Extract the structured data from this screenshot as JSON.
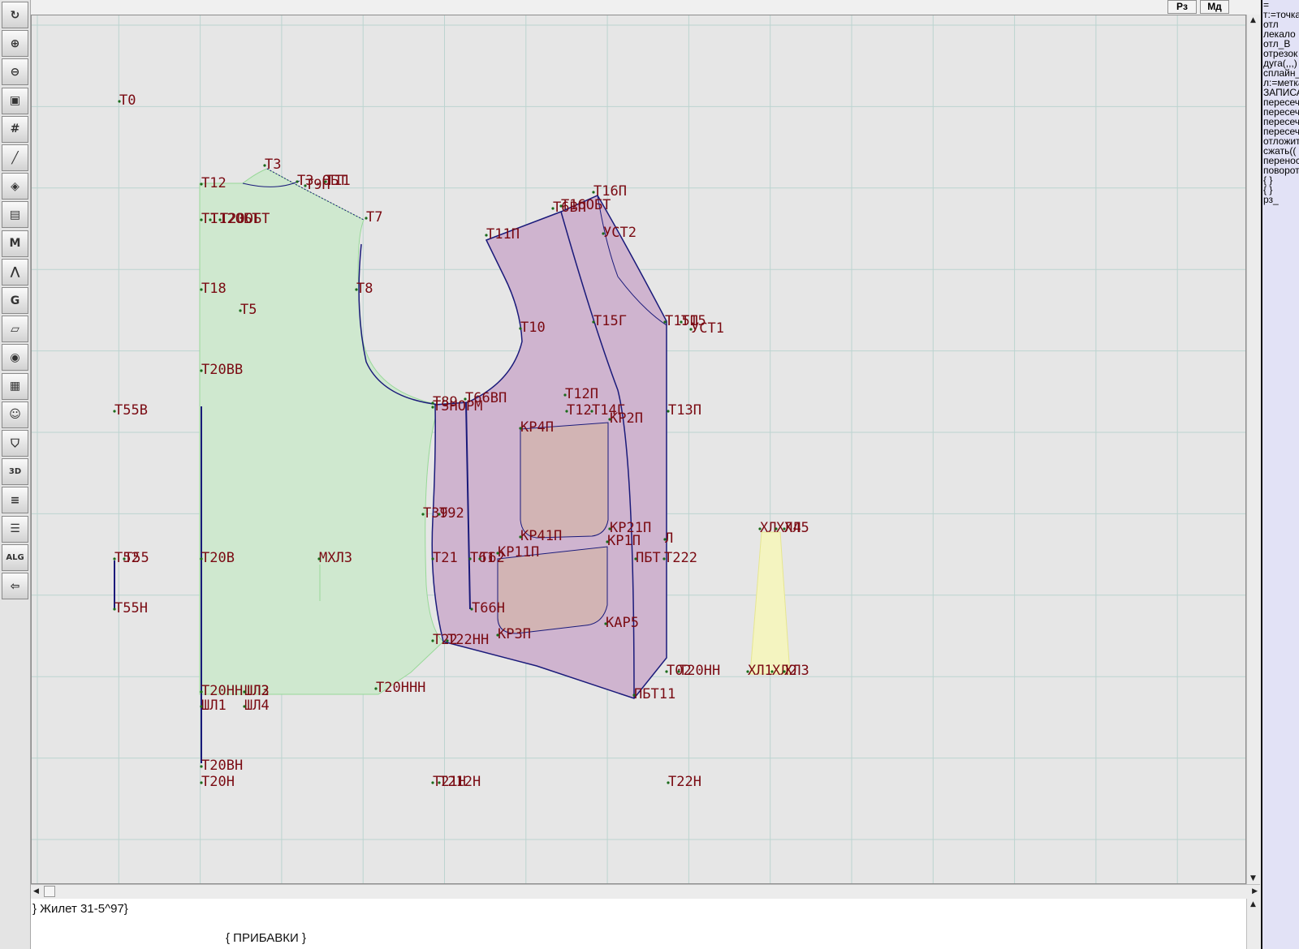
{
  "toolbar": {
    "tools": [
      {
        "icon": "refresh-icon",
        "glyph": "↻"
      },
      {
        "icon": "zoom-in-icon",
        "glyph": "⊕"
      },
      {
        "icon": "zoom-out-icon",
        "glyph": "⊖"
      },
      {
        "icon": "pattern-icon",
        "glyph": "▣"
      },
      {
        "icon": "grid-icon",
        "glyph": "#"
      },
      {
        "icon": "line-segment-icon",
        "glyph": "╱"
      },
      {
        "icon": "layers-icon",
        "glyph": "◈"
      },
      {
        "icon": "pattern-piece-icon",
        "glyph": "▤"
      },
      {
        "icon": "measurements-icon",
        "glyph": "M"
      },
      {
        "icon": "compass-icon",
        "glyph": "⋀"
      },
      {
        "icon": "grading-icon",
        "glyph": "G"
      },
      {
        "icon": "ruler-icon",
        "glyph": "▱"
      },
      {
        "icon": "camera-icon",
        "glyph": "◉"
      },
      {
        "icon": "document-icon",
        "glyph": "▦"
      },
      {
        "icon": "avatar-icon",
        "glyph": "☺"
      },
      {
        "icon": "jacket-icon",
        "glyph": "⛉"
      },
      {
        "icon": "3d-icon",
        "glyph": "3D"
      },
      {
        "icon": "text-icon",
        "glyph": "≡"
      },
      {
        "icon": "stack-icon",
        "glyph": "☰"
      },
      {
        "icon": "alg-icon",
        "glyph": "ALG"
      },
      {
        "icon": "exit-icon",
        "glyph": "⇦"
      }
    ]
  },
  "topbar": {
    "rz_label": "Рз",
    "md_label": "Мд"
  },
  "sidepanel": {
    "commands": [
      "=",
      "т:=точка",
      "отл",
      "лекало",
      "отл_В",
      "отрезок",
      "дуга(,,,)",
      "сплайн_",
      "л:=метка",
      "ЗАПИСА",
      "пересеч",
      "пересеч",
      "пересеч",
      "пересеч",
      "отложит",
      "сжать((",
      "перенос",
      "поворот",
      "{ }",
      "{ }",
      "рз_"
    ]
  },
  "editor": {
    "line1": "} Жилет 31-5^97}",
    "line2": "{  ПРИБАВКИ  }"
  },
  "drawing": {
    "colors": {
      "grid": "#bcd4d0",
      "back_fill": "#cfe8cf",
      "back_stroke": "#98d898",
      "front_fill": "#cfb4cf",
      "front_stroke": "#1a1a7a",
      "pocket_fill": "#d2b4b4",
      "dart_fill": "#f4f4c0",
      "label": "#7a0a12",
      "point": "#1a6a1a"
    },
    "labels": [
      "Т0",
      "Т3",
      "Т12",
      "Т3.ОБТ",
      "Т9П",
      "Т11",
      "Т7",
      "Т12ОБТ",
      "Т1",
      "Т20ОБТ",
      "Т18",
      "Т8",
      "Т5",
      "Т20ВВ",
      "Т55В",
      "Т16П",
      "Т16ОБТ",
      "Т6ВП",
      "УСТ2",
      "Т11П",
      "Т10",
      "Т15Г",
      "Т15П",
      "Т15",
      "УСТ1",
      "Т89",
      "Т66ВП",
      "Т3НОРМ",
      "Т12П",
      "Т12",
      "Т14Г",
      "КР2П",
      "Т13П",
      "КР4П",
      "Т39",
      "Т92",
      "КР21П",
      "КР41П",
      "КР1П",
      "Л",
      "ХЛ",
      "ХЛ4",
      "ХЛ5",
      "Т52",
      "Т55",
      "Т20В",
      "МХЛ3",
      "Т21",
      "Т61",
      "Т62",
      "КР11П",
      "ПБТ",
      "Т222",
      "Т55Н",
      "Т66Н",
      "КАР5",
      "КР3П",
      "Т22",
      "Т22НН",
      "Т20ННН",
      "Т20НН",
      "ШЛ2",
      "ШЛ3",
      "ШЛ1",
      "ШЛ4",
      "Т02",
      "Т20НН",
      "ХЛ1",
      "ХЛ2",
      "ХЛ3",
      "ПБТ11",
      "Т20ВН",
      "Т20Н",
      "Т21Н",
      "Т212Н",
      "Т22Н"
    ]
  }
}
